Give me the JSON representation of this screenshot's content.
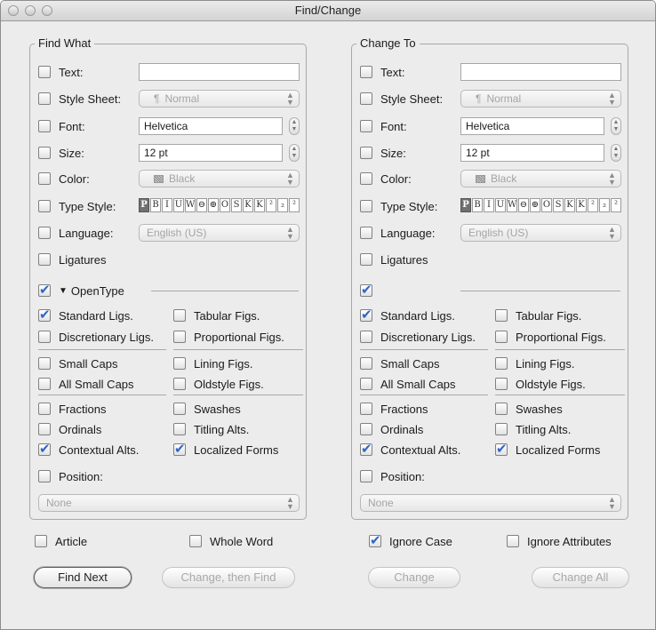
{
  "window": {
    "title": "Find/Change"
  },
  "find": {
    "legend": "Find What",
    "text": {
      "label": "Text:",
      "value": "",
      "checked": false
    },
    "style_sheet": {
      "label": "Style Sheet:",
      "value": "Normal",
      "icon": "pilcrow-icon",
      "checked": false
    },
    "font": {
      "label": "Font:",
      "value": "Helvetica",
      "checked": false
    },
    "size": {
      "label": "Size:",
      "value": "12 pt",
      "checked": false
    },
    "color": {
      "label": "Color:",
      "value": "Black",
      "checked": false
    },
    "type_style": {
      "label": "Type Style:",
      "checked": false
    },
    "language": {
      "label": "Language:",
      "value": "English (US)",
      "checked": false
    },
    "ligatures": {
      "label": "Ligatures",
      "checked": false
    },
    "opentype": {
      "label": "OpenType",
      "checked": true,
      "expanded": true
    },
    "ot_left": [
      {
        "label": "Standard Ligs.",
        "checked": true
      },
      {
        "label": "Discretionary Ligs.",
        "checked": false
      },
      {
        "label": "Small Caps",
        "checked": false
      },
      {
        "label": "All Small Caps",
        "checked": false
      },
      {
        "label": "Fractions",
        "checked": false
      },
      {
        "label": "Ordinals",
        "checked": false
      },
      {
        "label": "Contextual Alts.",
        "checked": true
      }
    ],
    "ot_right": [
      {
        "label": "Tabular Figs.",
        "checked": false
      },
      {
        "label": "Proportional Figs.",
        "checked": false
      },
      {
        "label": "Lining Figs.",
        "checked": false
      },
      {
        "label": "Oldstyle Figs.",
        "checked": false
      },
      {
        "label": "Swashes",
        "checked": false
      },
      {
        "label": "Titling Alts.",
        "checked": false
      },
      {
        "label": "Localized Forms",
        "checked": true
      }
    ],
    "position": {
      "label": "Position:",
      "value": "None",
      "checked": false
    }
  },
  "change": {
    "legend": "Change To",
    "text": {
      "label": "Text:",
      "value": "",
      "checked": false
    },
    "style_sheet": {
      "label": "Style Sheet:",
      "value": "Normal",
      "icon": "pilcrow-icon",
      "checked": false
    },
    "font": {
      "label": "Font:",
      "value": "Helvetica",
      "checked": false
    },
    "size": {
      "label": "Size:",
      "value": "12 pt",
      "checked": false
    },
    "color": {
      "label": "Color:",
      "value": "Black",
      "checked": false
    },
    "type_style": {
      "label": "Type Style:",
      "checked": false
    },
    "language": {
      "label": "Language:",
      "value": "English (US)",
      "checked": false
    },
    "ligatures": {
      "label": "Ligatures",
      "checked": false
    },
    "opentype": {
      "label": "",
      "checked": true
    },
    "ot_left": [
      {
        "label": "Standard Ligs.",
        "checked": true
      },
      {
        "label": "Discretionary Ligs.",
        "checked": false
      },
      {
        "label": "Small Caps",
        "checked": false
      },
      {
        "label": "All Small Caps",
        "checked": false
      },
      {
        "label": "Fractions",
        "checked": false
      },
      {
        "label": "Ordinals",
        "checked": false
      },
      {
        "label": "Contextual Alts.",
        "checked": true
      }
    ],
    "ot_right": [
      {
        "label": "Tabular Figs.",
        "checked": false
      },
      {
        "label": "Proportional Figs.",
        "checked": false
      },
      {
        "label": "Lining Figs.",
        "checked": false
      },
      {
        "label": "Oldstyle Figs.",
        "checked": false
      },
      {
        "label": "Swashes",
        "checked": false
      },
      {
        "label": "Titling Alts.",
        "checked": false
      },
      {
        "label": "Localized Forms",
        "checked": true
      }
    ],
    "position": {
      "label": "Position:",
      "value": "None",
      "checked": false
    }
  },
  "type_style_buttons": [
    "P",
    "B",
    "I",
    "U",
    "W",
    "⊖",
    "⊕",
    "O",
    "S",
    "K",
    "K",
    "²",
    "₂",
    "²"
  ],
  "options": {
    "article": {
      "label": "Article",
      "checked": false
    },
    "whole_word": {
      "label": "Whole Word",
      "checked": false
    },
    "ignore_case": {
      "label": "Ignore Case",
      "checked": true
    },
    "ignore_attributes": {
      "label": "Ignore Attributes",
      "checked": false
    }
  },
  "buttons": {
    "find_next": "Find Next",
    "change_then_find": "Change, then Find",
    "change": "Change",
    "change_all": "Change All"
  },
  "colors": {
    "check_accent": "#2f66c7",
    "window_bg": "#ececec"
  }
}
